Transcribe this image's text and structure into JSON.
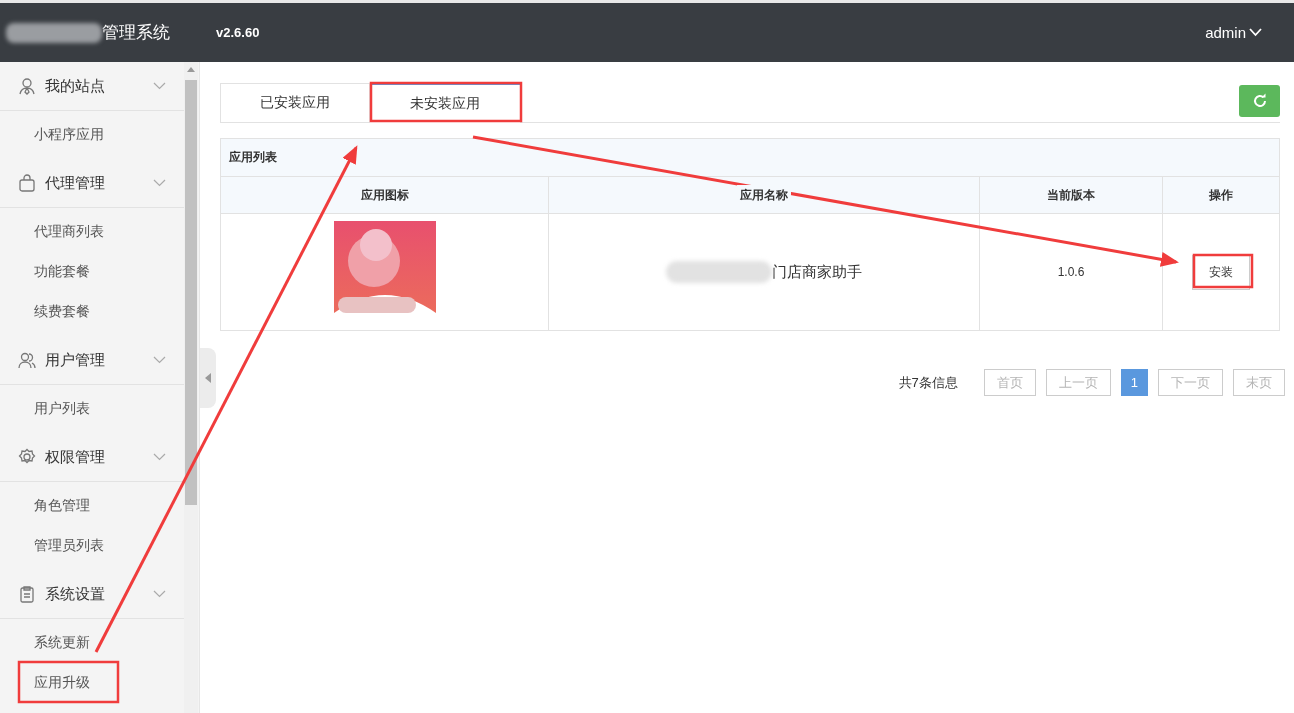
{
  "header": {
    "title": "管理系统",
    "version": "v2.6.60",
    "user": "admin"
  },
  "sidebar": {
    "groups": [
      {
        "label": "我的站点",
        "items": [
          {
            "label": "小程序应用"
          }
        ]
      },
      {
        "label": "代理管理",
        "items": [
          {
            "label": "代理商列表"
          },
          {
            "label": "功能套餐"
          },
          {
            "label": "续费套餐"
          }
        ]
      },
      {
        "label": "用户管理",
        "items": [
          {
            "label": "用户列表"
          }
        ]
      },
      {
        "label": "权限管理",
        "items": [
          {
            "label": "角色管理"
          },
          {
            "label": "管理员列表"
          }
        ]
      },
      {
        "label": "系统设置",
        "items": [
          {
            "label": "系统更新"
          },
          {
            "label": "应用升级"
          }
        ]
      }
    ]
  },
  "tabs": [
    {
      "label": "已安装应用",
      "selected": false
    },
    {
      "label": "未安装应用",
      "selected": true
    }
  ],
  "table": {
    "title": "应用列表",
    "columns": [
      "应用图标",
      "应用名称",
      "当前版本",
      "操作"
    ],
    "rows": [
      {
        "name": "门店商家助手",
        "version": "1.0.6",
        "action": "安装"
      }
    ]
  },
  "pagination": {
    "summary": "共7条信息",
    "buttons": [
      {
        "label": "首页",
        "selected": false,
        "disabled": true
      },
      {
        "label": "上一页",
        "selected": false,
        "disabled": true
      },
      {
        "label": "1",
        "selected": true,
        "disabled": false
      },
      {
        "label": "下一页",
        "selected": false,
        "disabled": true
      },
      {
        "label": "末页",
        "selected": false,
        "disabled": true
      }
    ]
  }
}
